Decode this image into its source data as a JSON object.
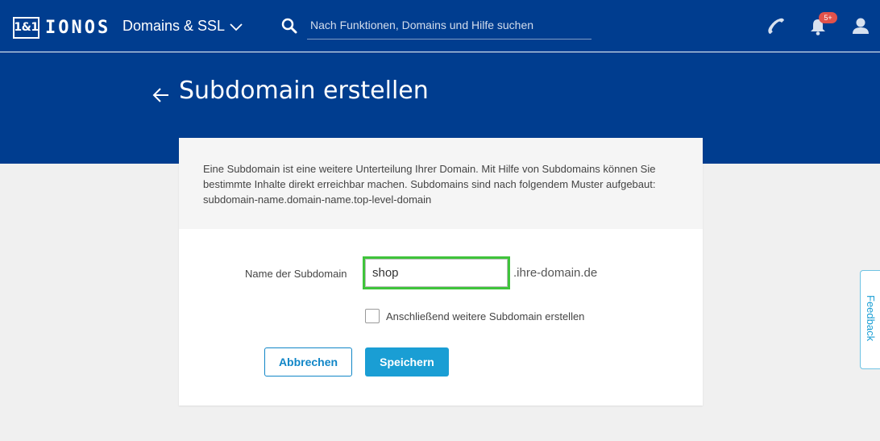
{
  "header": {
    "logo_box": "1&1",
    "logo_text": "IONOS",
    "section_menu": "Domains & SSL",
    "search_placeholder": "Nach Funktionen, Domains und Hilfe suchen",
    "notification_badge": "5+"
  },
  "page": {
    "title": "Subdomain erstellen"
  },
  "form": {
    "info_text": "Eine Subdomain ist eine weitere Unterteilung Ihrer Domain. Mit Hilfe von Subdomains können Sie bestimmte Inhalte direkt erreichbar machen. Subdomains sind nach folgendem Muster aufgebaut: subdomain-name.domain-name.top-level-domain",
    "name_label": "Name der Subdomain",
    "name_value": "shop",
    "domain_suffix": ".ihre-domain.de",
    "checkbox_label": "Anschließend weitere Subdomain erstellen",
    "checkbox_checked": false,
    "cancel_label": "Abbrechen",
    "save_label": "Speichern"
  },
  "feedback": {
    "label": "Feedback"
  },
  "colors": {
    "header_bg": "#003d8f",
    "accent": "#1a9ed4",
    "input_highlight": "#3fc43b",
    "badge": "#e1524b"
  },
  "icons": [
    "back-arrow-icon",
    "chevron-down-icon",
    "search-icon",
    "phone-icon",
    "bell-icon",
    "user-icon"
  ]
}
